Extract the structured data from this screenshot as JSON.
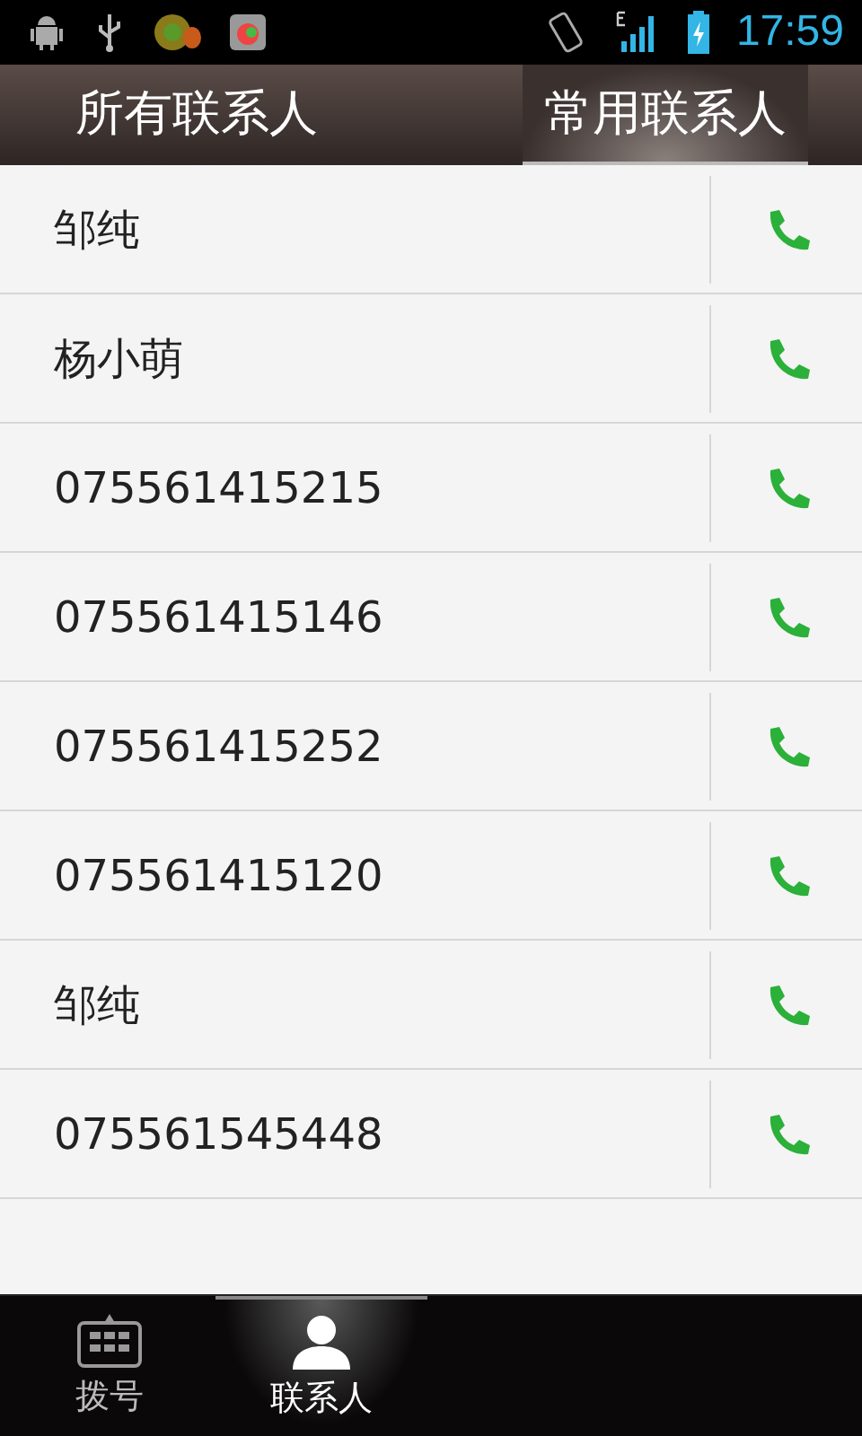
{
  "status_bar": {
    "time": "17:59"
  },
  "tabs": [
    {
      "label": "所有联系人",
      "selected": false
    },
    {
      "label": "常用联系人",
      "selected": true
    }
  ],
  "contacts": [
    {
      "name": "邹纯"
    },
    {
      "name": "杨小萌"
    },
    {
      "name": "075561415215"
    },
    {
      "name": "075561415146"
    },
    {
      "name": "075561415252"
    },
    {
      "name": "075561415120"
    },
    {
      "name": "邹纯"
    },
    {
      "name": "075561545448"
    }
  ],
  "bottom_tabs": [
    {
      "label": "拨号",
      "kind": "dialpad",
      "selected": false
    },
    {
      "label": "联系人",
      "kind": "person",
      "selected": true
    }
  ]
}
